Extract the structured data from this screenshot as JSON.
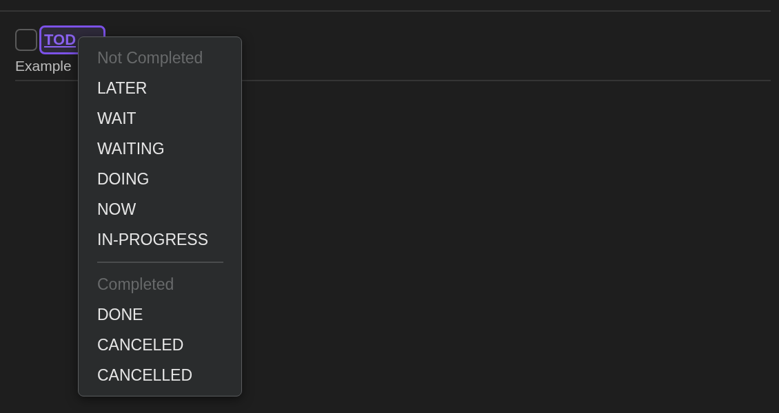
{
  "task": {
    "checked": false,
    "tag": "TOD",
    "note": "Example"
  },
  "menu": {
    "groups": [
      {
        "heading": "Not Completed",
        "items": [
          "LATER",
          "WAIT",
          "WAITING",
          "DOING",
          "NOW",
          "IN-PROGRESS"
        ]
      },
      {
        "heading": "Completed",
        "items": [
          "DONE",
          "CANCELED",
          "CANCELLED"
        ]
      }
    ]
  }
}
